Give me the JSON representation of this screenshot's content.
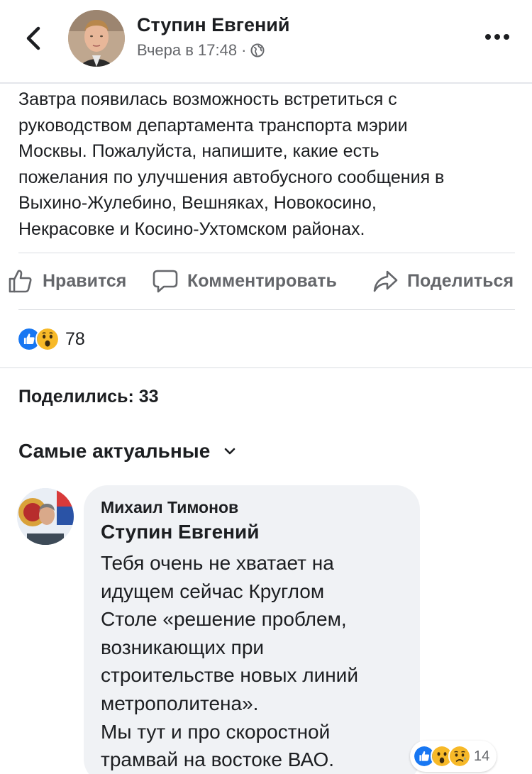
{
  "header": {
    "author_name": "Ступин Евгений",
    "timestamp": "Вчера в 17:48",
    "meta_separator": "·",
    "privacy_icon": "globe-icon",
    "back_icon": "chevron-left-icon",
    "more_icon": "more-horizontal-icon"
  },
  "post": {
    "text": "Завтра появилась возможность встретиться с\nруководством департамента транспорта мэрии\nМосквы. Пожалуйста, напишите, какие есть\nпожелания по улучшения автобусного сообщения в\nВыхино-Жулебино, Вешняках, Новокосино,\nНекрасовке и Косино-Ухтомском районах."
  },
  "actions": {
    "like_label": "Нравится",
    "comment_label": "Комментировать",
    "share_label": "Поделиться"
  },
  "reactions": {
    "types": [
      "like",
      "wow"
    ],
    "count": "78"
  },
  "shares": {
    "label": "Поделились: 33"
  },
  "comments_sort": {
    "label": "Самые актуальные"
  },
  "comment": {
    "author": "Михаил Тимонов",
    "mention": "Ступин Евгений",
    "text": "Тебя очень не хватает на\nидущем сейчас Круглом\nСтоле «решение проблем,\nвозникающих при\nстроительстве новых линий\nметрополитена».\nМы тут и про скоростной\nтрамвай на востоке ВАО.",
    "reactions": {
      "types": [
        "like",
        "wow",
        "sad"
      ],
      "count": "14"
    }
  },
  "colors": {
    "text_primary": "#1c1e21",
    "text_secondary": "#65676b",
    "like_blue": "#1877f2",
    "reaction_yellow": "#f7b928",
    "bubble_bg": "#f0f2f5",
    "divider": "#dadde1"
  }
}
